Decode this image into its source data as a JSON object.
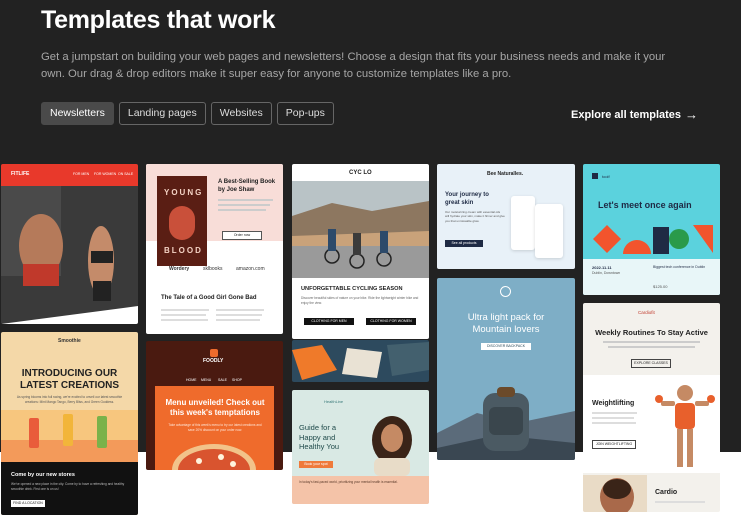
{
  "header": {
    "title": "Templates that work",
    "subtitle": "Get a jumpstart on building your web pages and newsletters! Choose a design that fits your business needs and make it your own. Our drag & drop editors make it super easy for anyone to customize templates like a pro."
  },
  "tabs": [
    {
      "label": "Newsletters",
      "active": true
    },
    {
      "label": "Landing pages"
    },
    {
      "label": "Websites"
    },
    {
      "label": "Pop-ups"
    }
  ],
  "explore": {
    "label": "Explore all templates",
    "arrow": "→"
  },
  "cards": {
    "fitlife": {
      "brand": "FITLIFE",
      "nav": [
        "FOR MEN",
        "FOR WOMEN",
        "ON SALE"
      ]
    },
    "smoothie": {
      "brand": "Smoothie",
      "headline": "INTRODUCING OUR LATEST CREATIONS",
      "body": "As spring blooms into full swing, we're excited to unveil our latest smoothie creations: Mint Mango Tango, Berry Bliss, and Green Goddess.",
      "cta_title": "Come by our new stores",
      "cta_text": "We've opened a new place in the city. Come by to have a refreshing and healthy smoothie drink. First one is on us!",
      "cta_button": "FIND A LOCATION"
    },
    "book": {
      "cover_top": "YOUNG",
      "cover_bottom": "BLOOD",
      "headline": "A Best-Selling Book by Joe Shaw",
      "button": "Order now",
      "logos": [
        "Wordery",
        "sklbooks",
        "amazon.com"
      ],
      "section": "The Tale of a Good Girl Gone Bad"
    },
    "foodly": {
      "brand": "FOODLY",
      "nav": [
        "HOME",
        "MENU",
        "SALE",
        "SHOP"
      ],
      "headline": "Menu unveiled! Check out this week's temptations",
      "body": "Take advantage of this week's menu to try our latest creations and save 20% discount on your order now."
    },
    "cycling": {
      "brand": "CYC LO",
      "headline": "UNFORGETTABLE CYCLING SEASON",
      "body": "Discover beautiful sides of nature on your bike. Ride the lightweight winter bike and enjoy the view.",
      "btn_men": "CLOTHING FOR MEN",
      "btn_women": "CLOTHING FOR WOMEN"
    },
    "health": {
      "brand": "HealthLine",
      "headline": "Guide for a Happy and Healthy You",
      "button": "Book your spot",
      "body": "In today's fast-paced world, prioritizing your mental health is essential."
    },
    "bee": {
      "brand": "Bee Naturalles.",
      "headline": "Your journey to great skin",
      "body": "Our moisturizing cream with essential oils will hydrate your skin, make it firmer and give you that unmissable glow.",
      "button": "See all products"
    },
    "mountain": {
      "headline": "Ultra light pack for Mountain lovers",
      "button": "DISCOVER BACKPACK"
    },
    "meet": {
      "brand": "toolf",
      "headline": "Let's meet once again",
      "date": "2022.11.11",
      "location": "Dublin, Downtown",
      "side": "Biggest tech conference in Dublin",
      "price": "$125.00"
    },
    "cardio": {
      "brand": "Cardiofit",
      "headline": "Weekly Routines To Stay Active",
      "button": "EXPLORE CLASSES",
      "section": "Weightlifting",
      "section_btn": "JOIN WEIGHTLIFTING",
      "section2": "Cardio"
    }
  },
  "colors": {
    "bg": "#222222",
    "accent_red": "#e8392b",
    "teal": "#5bd2dd",
    "orange": "#ef6b2c"
  }
}
